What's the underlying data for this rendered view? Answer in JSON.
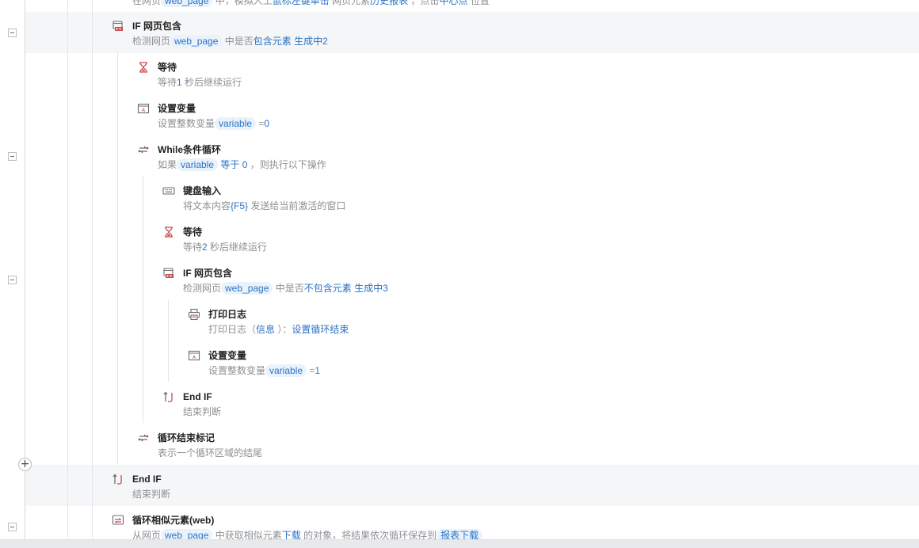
{
  "top_partial": {
    "desc": [
      {
        "t": "在网页",
        "k": "plain"
      },
      {
        "t": "web_page",
        "k": "pill"
      },
      {
        "t": "中，模拟人工",
        "k": "plain"
      },
      {
        "t": "鼠标左键单击",
        "k": "hl"
      },
      {
        "t": "网页元素",
        "k": "plain"
      },
      {
        "t": "历史报表",
        "k": "hl"
      },
      {
        "t": "，点击",
        "k": "plain"
      },
      {
        "t": "中心点",
        "k": "hl"
      },
      {
        "t": "位置",
        "k": "plain"
      }
    ]
  },
  "steps": [
    {
      "title": "IF 网页包含",
      "icon": "web-if-icon",
      "desc": [
        {
          "t": "检测网页",
          "k": "plain"
        },
        {
          "t": "web_page",
          "k": "pill"
        },
        {
          "t": "中是否",
          "k": "plain"
        },
        {
          "t": "包含元素",
          "k": "hl"
        },
        {
          "t": "生成中2",
          "k": "hl"
        }
      ]
    },
    {
      "title": "等待",
      "icon": "hourglass-icon",
      "desc": [
        {
          "t": "等待",
          "k": "plain"
        },
        {
          "t": "1",
          "k": "hl"
        },
        {
          "t": "秒后继续运行",
          "k": "plain"
        }
      ]
    },
    {
      "title": "设置变量",
      "icon": "variable-icon",
      "desc": [
        {
          "t": "设置整数变量",
          "k": "plain"
        },
        {
          "t": "variable",
          "k": "pill"
        },
        {
          "t": "=",
          "k": "plain"
        },
        {
          "t": "0",
          "k": "hl"
        }
      ]
    },
    {
      "title": "While条件循环",
      "icon": "loop-icon",
      "desc": [
        {
          "t": "如果",
          "k": "plain"
        },
        {
          "t": "variable",
          "k": "pill"
        },
        {
          "t": "等于",
          "k": "hl"
        },
        {
          "t": "0",
          "k": "hl"
        },
        {
          "t": "，则执行以下操作",
          "k": "plain"
        }
      ]
    },
    {
      "title": "键盘输入",
      "icon": "keyboard-icon",
      "desc": [
        {
          "t": "将文本内容",
          "k": "plain"
        },
        {
          "t": "{F5}",
          "k": "hl"
        },
        {
          "t": "发送给当前激活的窗口",
          "k": "plain"
        }
      ]
    },
    {
      "title": "等待",
      "icon": "hourglass-icon",
      "desc": [
        {
          "t": "等待",
          "k": "plain"
        },
        {
          "t": "2",
          "k": "hl"
        },
        {
          "t": "秒后继续运行",
          "k": "plain"
        }
      ]
    },
    {
      "title": "IF 网页包含",
      "icon": "web-if-icon",
      "desc": [
        {
          "t": "检测网页",
          "k": "plain"
        },
        {
          "t": "web_page",
          "k": "pill"
        },
        {
          "t": "中是否",
          "k": "plain"
        },
        {
          "t": "不包含元素",
          "k": "hl"
        },
        {
          "t": "生成中3",
          "k": "hl"
        }
      ]
    },
    {
      "title": "打印日志",
      "icon": "print-icon",
      "desc": [
        {
          "t": "打印日志（",
          "k": "plain"
        },
        {
          "t": "信息",
          "k": "hl"
        },
        {
          "t": "）：",
          "k": "plain"
        },
        {
          "t": "设置循环结束",
          "k": "hl"
        }
      ]
    },
    {
      "title": "设置变量",
      "icon": "variable-icon",
      "desc": [
        {
          "t": "设置整数变量",
          "k": "plain"
        },
        {
          "t": "variable",
          "k": "pill"
        },
        {
          "t": "=",
          "k": "plain"
        },
        {
          "t": "1",
          "k": "hl"
        }
      ]
    },
    {
      "title": "End IF",
      "icon": "end-if-icon",
      "desc": [
        {
          "t": "结束判断",
          "k": "plain"
        }
      ]
    },
    {
      "title": "循环结束标记",
      "icon": "loop-icon",
      "desc": [
        {
          "t": "表示一个循环区域的结尾",
          "k": "plain"
        }
      ]
    },
    {
      "title": "End IF",
      "icon": "end-if-icon",
      "desc": [
        {
          "t": "结束判断",
          "k": "plain"
        }
      ]
    },
    {
      "title": "循环相似元素(web)",
      "icon": "loop-web-icon",
      "desc": [
        {
          "t": "从网页",
          "k": "plain"
        },
        {
          "t": "web_page",
          "k": "pill"
        },
        {
          "t": "中获取相似元素",
          "k": "plain"
        },
        {
          "t": "下载",
          "k": "hl"
        },
        {
          "t": "的对象，将结果依次循环保存到",
          "k": "plain"
        },
        {
          "t": "报表下载",
          "k": "pill"
        }
      ]
    }
  ],
  "colors": {
    "accent": "#2b72c4",
    "pill_bg": "#eaf3fc",
    "row_shade": "#f5f6f8",
    "icon_red": "#c94a4a"
  }
}
